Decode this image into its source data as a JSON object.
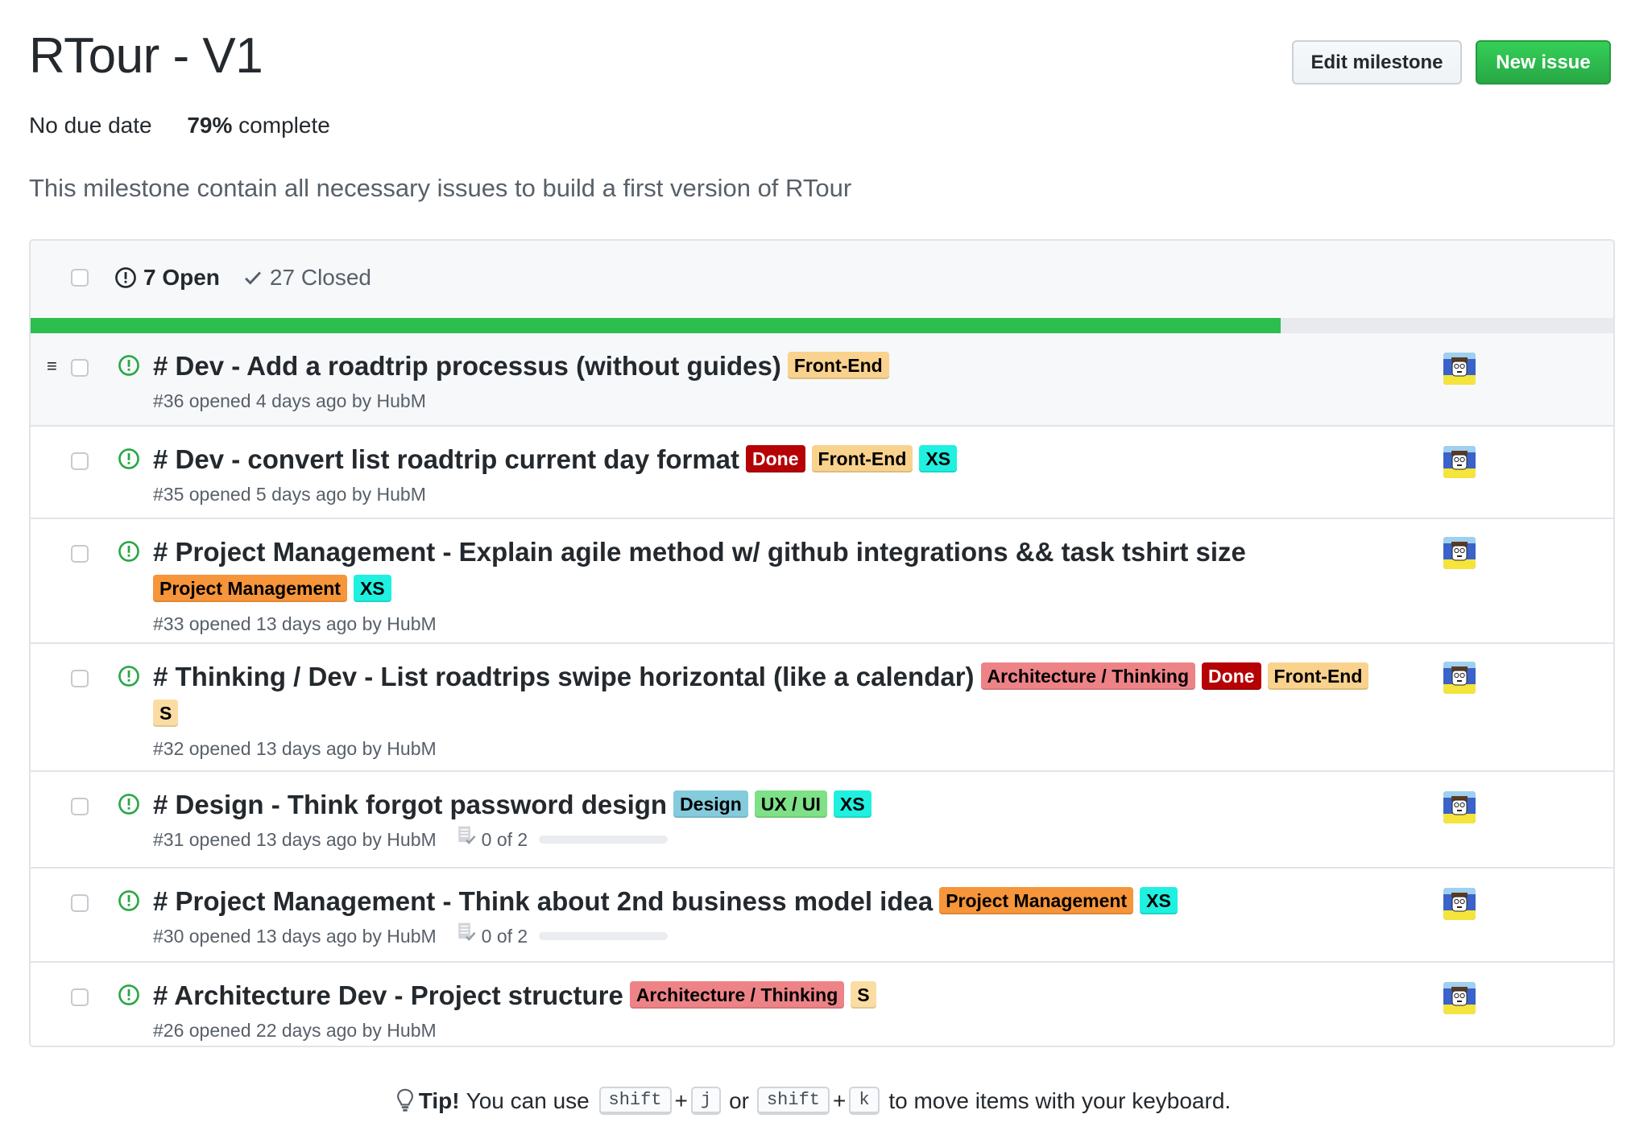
{
  "milestone": {
    "title": "RTour - V1",
    "due": "No due date",
    "percent_label": "79%",
    "complete_label": " complete",
    "progress": 0.79,
    "description": "This milestone contain all necessary issues to build a first version of RTour"
  },
  "actions": {
    "edit_label": "Edit milestone",
    "new_label": "New issue"
  },
  "colors": {
    "accent_green": "#2cbe4e",
    "open_icon": "#28a745"
  },
  "list_header": {
    "open_label": "7 Open",
    "closed_label": "27 Closed"
  },
  "issues": [
    {
      "title": "# Dev - Add a roadtrip processus (without guides)",
      "labels": [
        {
          "name": "Front-End",
          "bg": "#f9d28e",
          "fg": "#000000"
        }
      ],
      "meta": "#36 opened 4 days ago by HubM",
      "tasks": null,
      "author_avatar": "avatar-hubm"
    },
    {
      "title": "# Dev - convert list roadtrip current day format",
      "labels": [
        {
          "name": "Done",
          "bg": "#b60205",
          "fg": "#ffffff"
        },
        {
          "name": "Front-End",
          "bg": "#f9d28e",
          "fg": "#000000"
        },
        {
          "name": "XS",
          "bg": "#1ff0e0",
          "fg": "#000000"
        }
      ],
      "meta": "#35 opened 5 days ago by HubM",
      "tasks": null,
      "author_avatar": "avatar-hubm"
    },
    {
      "title": "# Project Management - Explain agile method w/ github integrations && task tshirt size",
      "labels": [
        {
          "name": "Project Management",
          "bg": "#f7953a",
          "fg": "#000000"
        },
        {
          "name": "XS",
          "bg": "#1ff0e0",
          "fg": "#000000"
        }
      ],
      "meta": "#33 opened 13 days ago by HubM",
      "tasks": null,
      "author_avatar": "avatar-hubm"
    },
    {
      "title": "# Thinking / Dev - List roadtrips swipe horizontal (like a calendar)",
      "labels": [
        {
          "name": "Architecture / Thinking",
          "bg": "#ee8387",
          "fg": "#000000"
        },
        {
          "name": "Done",
          "bg": "#b60205",
          "fg": "#ffffff"
        },
        {
          "name": "Front-End",
          "bg": "#f9d28e",
          "fg": "#000000"
        },
        {
          "name": "S",
          "bg": "#fbdda3",
          "fg": "#000000"
        }
      ],
      "meta": "#32 opened 13 days ago by HubM",
      "tasks": null,
      "author_avatar": "avatar-hubm"
    },
    {
      "title": "# Design - Think forgot password design",
      "labels": [
        {
          "name": "Design",
          "bg": "#84cbdc",
          "fg": "#000000"
        },
        {
          "name": "UX / UI",
          "bg": "#7ee087",
          "fg": "#000000"
        },
        {
          "name": "XS",
          "bg": "#1ff0e0",
          "fg": "#000000"
        }
      ],
      "meta": "#31 opened 13 days ago by HubM",
      "tasks": {
        "text": "0 of 2",
        "done": 0,
        "total": 2
      },
      "author_avatar": "avatar-hubm"
    },
    {
      "title": "# Project Management - Think about 2nd business model idea",
      "labels": [
        {
          "name": "Project Management",
          "bg": "#f7953a",
          "fg": "#000000"
        },
        {
          "name": "XS",
          "bg": "#1ff0e0",
          "fg": "#000000"
        }
      ],
      "meta": "#30 opened 13 days ago by HubM",
      "tasks": {
        "text": "0 of 2",
        "done": 0,
        "total": 2
      },
      "author_avatar": "avatar-hubm"
    },
    {
      "title": "# Architecture Dev - Project structure",
      "labels": [
        {
          "name": "Architecture / Thinking",
          "bg": "#ee8387",
          "fg": "#000000"
        },
        {
          "name": "S",
          "bg": "#fbdda3",
          "fg": "#000000"
        }
      ],
      "meta": "#26 opened 22 days ago by HubM",
      "tasks": null,
      "author_avatar": "avatar-hubm"
    }
  ],
  "tip": {
    "icon": "lightbulb-icon",
    "bold": "Tip!",
    "prefix": "You can use",
    "key1a": "shift",
    "plus1": "+",
    "key1b": "j",
    "or": "or",
    "key2a": "shift",
    "plus2": "+",
    "key2b": "k",
    "suffix": "to move items with your keyboard."
  }
}
